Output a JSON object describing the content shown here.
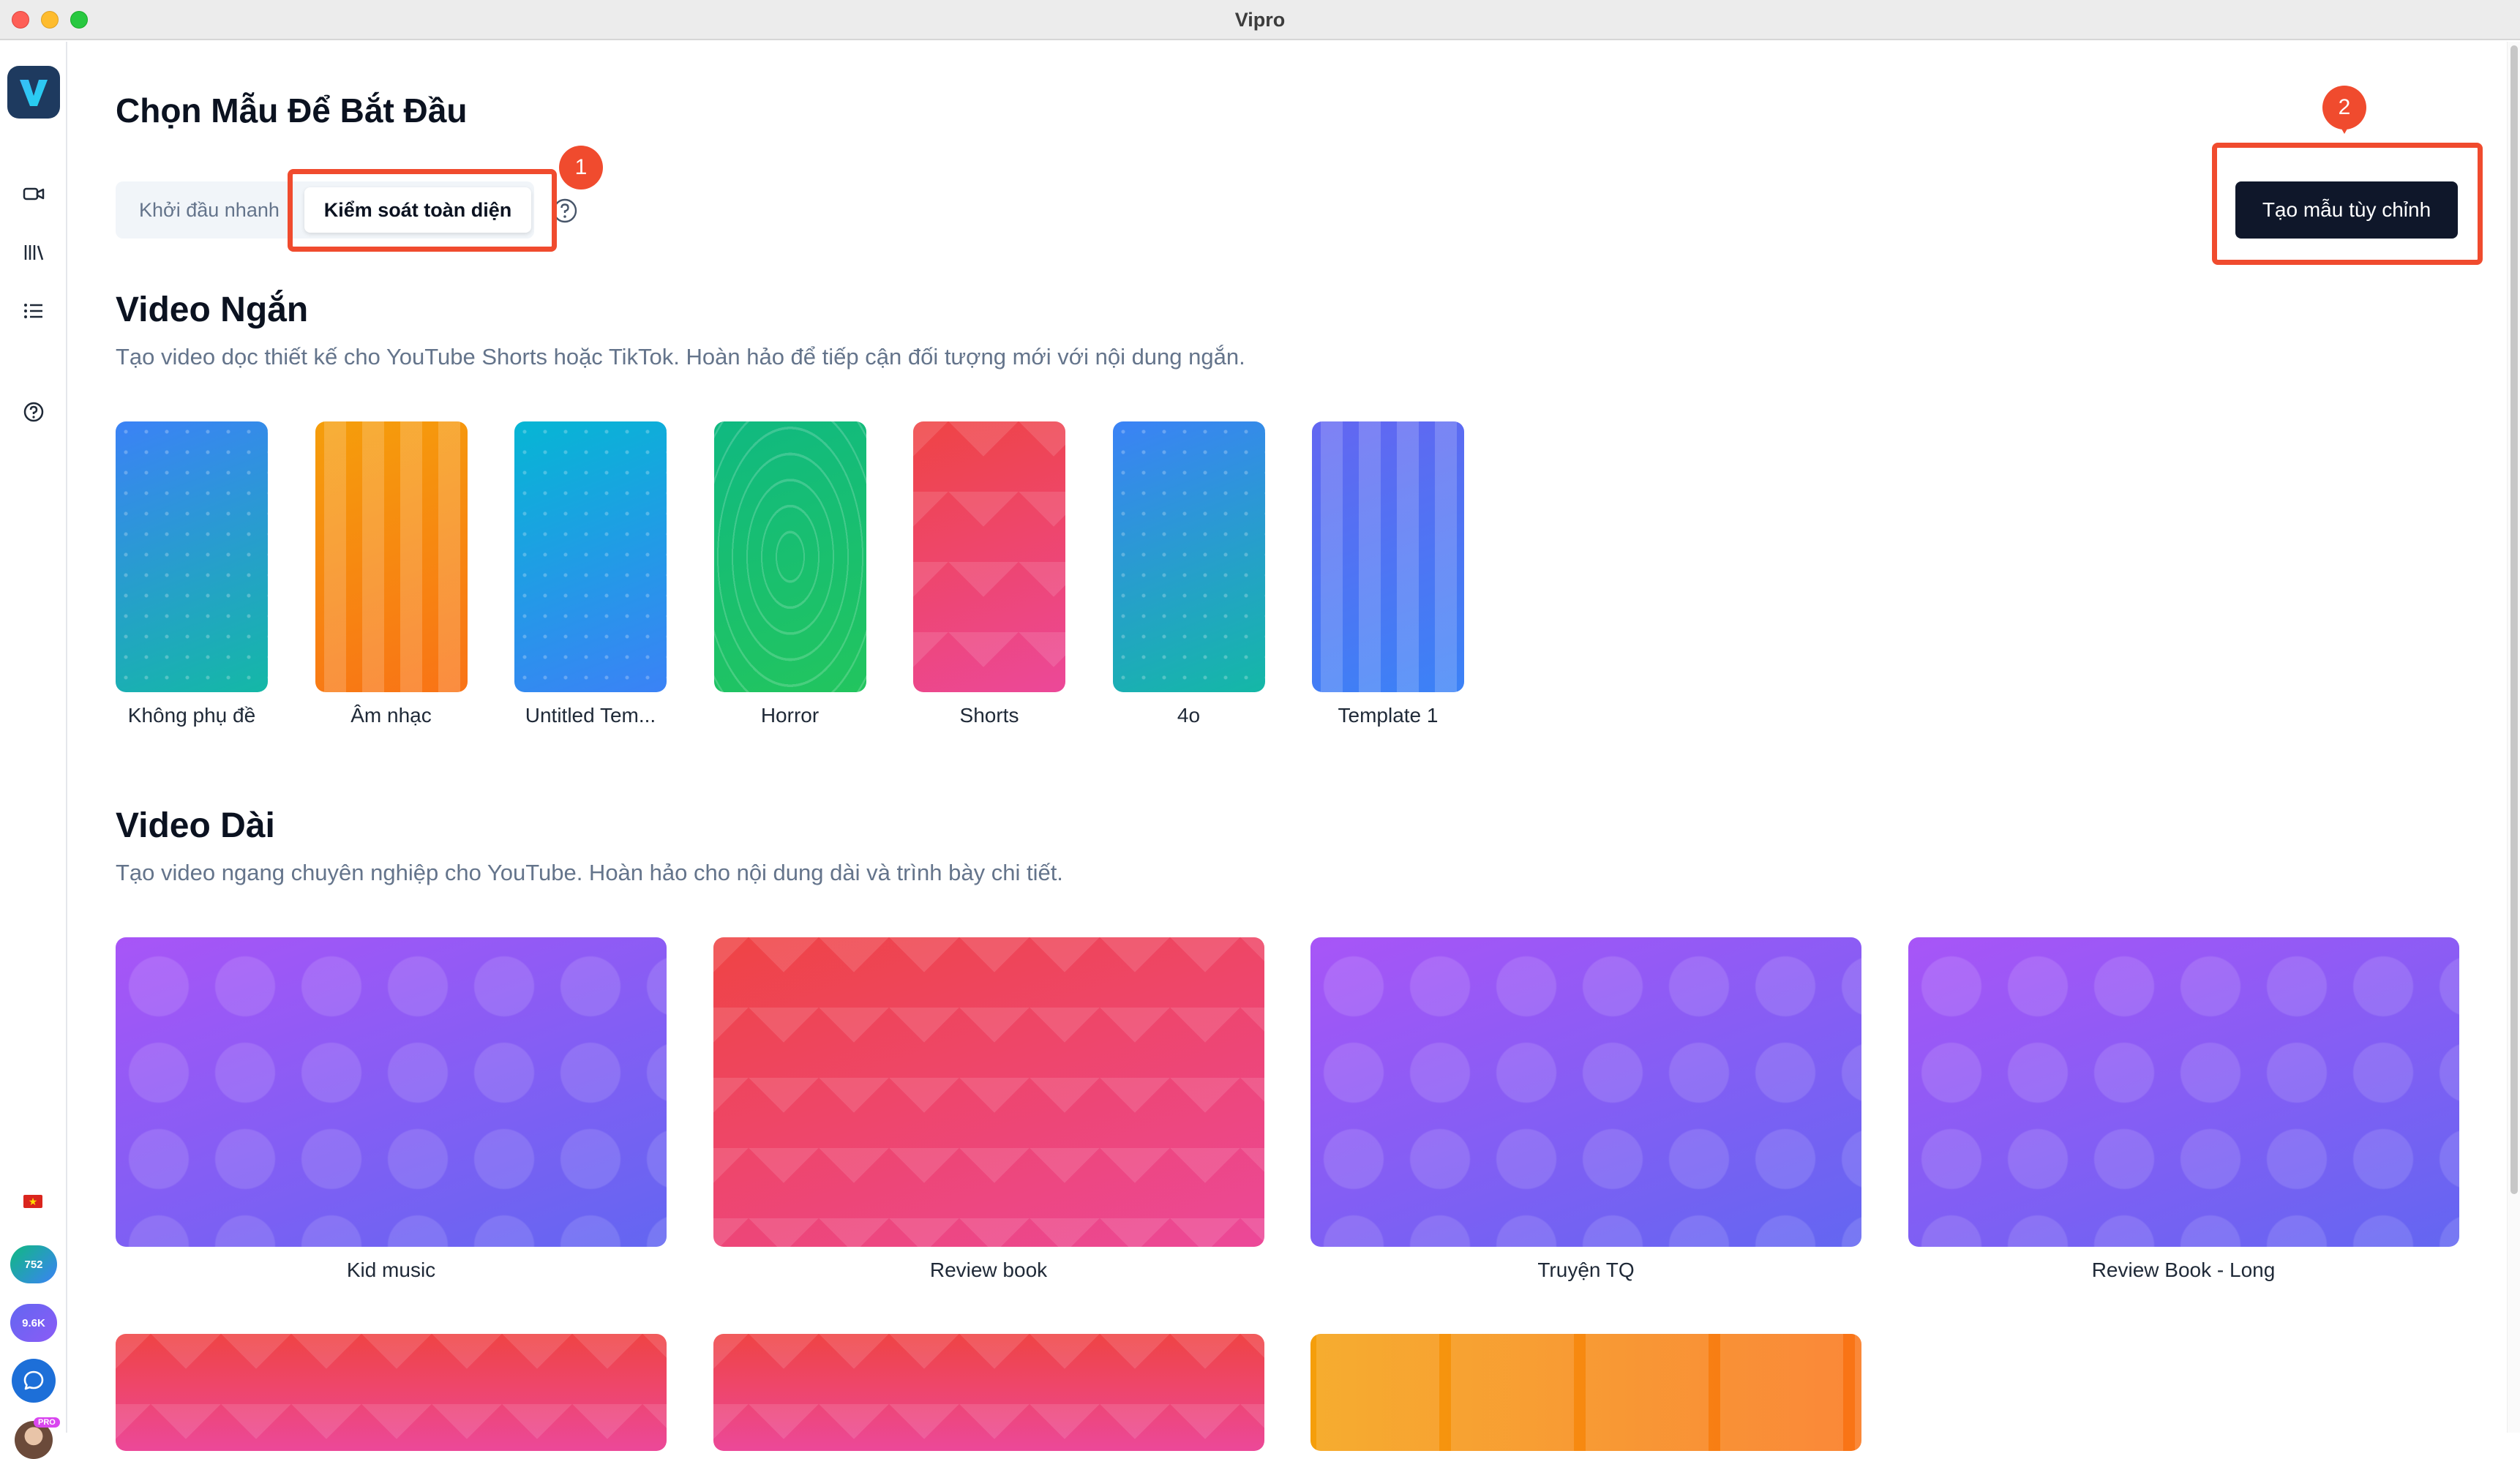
{
  "window": {
    "title": "Vipro"
  },
  "sidebar": {
    "nav_icons": [
      "video-camera-icon",
      "library-icon",
      "list-icon",
      "help-icon"
    ],
    "credits": [
      {
        "value": "752"
      },
      {
        "value": "9.6K"
      }
    ],
    "avatar_badge": "PRO"
  },
  "header": {
    "title": "Chọn Mẫu Để Bắt Đầu",
    "tabs": [
      {
        "label": "Khởi đầu nhanh",
        "active": false
      },
      {
        "label": "Kiểm soát toàn diện",
        "active": true
      }
    ],
    "create_button": "Tạo mẫu tùy chỉnh",
    "annotations": [
      "1",
      "2"
    ]
  },
  "short_videos": {
    "title": "Video Ngắn",
    "description": "Tạo video dọc thiết kế cho YouTube Shorts hoặc TikTok. Hoàn hảo để tiếp cận đối tượng mới với nội dung ngắn.",
    "templates": [
      {
        "label": "Không phụ đề",
        "gradient": [
          "#3b82f6",
          "#14b8a6"
        ]
      },
      {
        "label": "Âm nhạc",
        "gradient": [
          "#f59e0b",
          "#f97316"
        ]
      },
      {
        "label": "Untitled Tem...",
        "gradient": [
          "#06b6d4",
          "#3b82f6"
        ]
      },
      {
        "label": "Horror",
        "gradient": [
          "#10b981",
          "#22c55e"
        ]
      },
      {
        "label": "Shorts",
        "gradient": [
          "#ef4444",
          "#ec4899"
        ]
      },
      {
        "label": "4o",
        "gradient": [
          "#3b82f6",
          "#14b8a6"
        ]
      },
      {
        "label": "Template 1",
        "gradient": [
          "#6366f1",
          "#3b82f6"
        ]
      }
    ]
  },
  "long_videos": {
    "title": "Video Dài",
    "description": "Tạo video ngang chuyên nghiệp cho YouTube. Hoàn hảo cho nội dung dài và trình bày chi tiết.",
    "templates": [
      {
        "label": "Kid music",
        "gradient": [
          "#a855f7",
          "#6366f1"
        ]
      },
      {
        "label": "Review book",
        "gradient": [
          "#ef4444",
          "#ec4899"
        ]
      },
      {
        "label": "Truyện TQ",
        "gradient": [
          "#a855f7",
          "#6366f1"
        ]
      },
      {
        "label": "Review Book - Long",
        "gradient": [
          "#a855f7",
          "#6366f1"
        ]
      }
    ]
  }
}
